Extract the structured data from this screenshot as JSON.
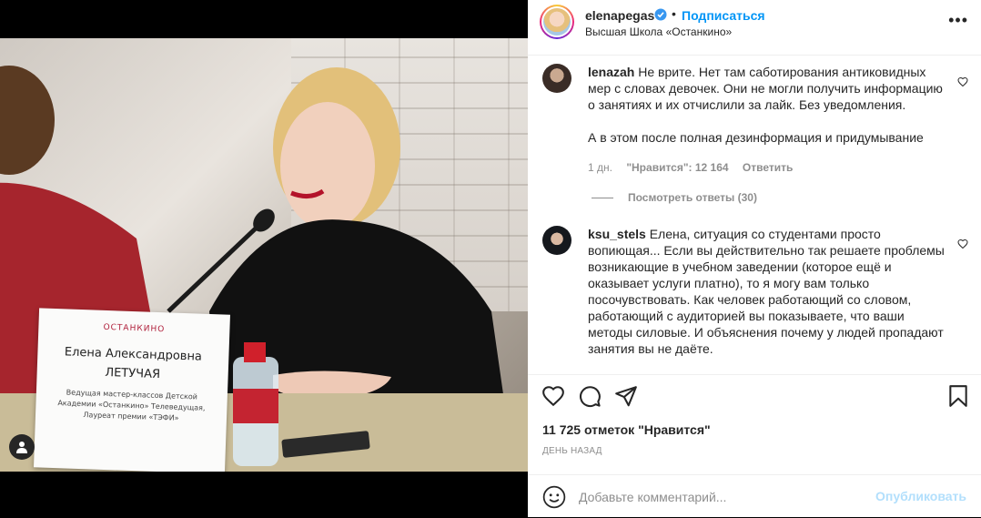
{
  "post": {
    "username": "elenapegas",
    "follow_label": "Подписаться",
    "separator": "•",
    "location": "Высшая Школа «Останкино»",
    "more_label": "•••"
  },
  "media": {
    "namecard": {
      "brand": "ОСТАНКИНО",
      "name": "Елена Александровна",
      "surname": "ЛЕТУЧАЯ",
      "description": "Ведущая мастер-классов Детской Академии «Останкино» Телеведущая, Лауреат премии «ТЭФИ»"
    }
  },
  "comments": [
    {
      "username": "lenazah",
      "text": "Не врите. Нет там саботирования антиковидных мер с словах девочек. Они не могли получить информацию о занятиях и их отчислили за лайк. Без уведомления.",
      "text2": "А в этом после полная дезинформация и придумывание",
      "time": "1 дн.",
      "likes": "\"Нравится\": 12 164",
      "reply_label": "Ответить",
      "view_replies": "Посмотреть ответы (30)"
    },
    {
      "username": "ksu_stels",
      "text": "Елена, ситуация со студентами просто вопиющая... Если вы действительно так решаете проблемы возникающие в учебном заведении (которое ещё и оказывает услуги платно), то я могу вам только посочувствовать. Как человек работающий со словом, работающий с аудиторией вы показываете, что ваши методы силовые. И объяснения почему у людей пропадают занятия вы не даёте."
    }
  ],
  "actions": {
    "likes_count": "11 725 отметок \"Нравится\"",
    "date": "ДЕНЬ НАЗАД"
  },
  "composer": {
    "placeholder": "Добавьте комментарий...",
    "post_label": "Опубликовать"
  },
  "colors": {
    "link_blue": "#0095f6",
    "post_disabled": "#b2dffc",
    "secondary_text": "#8e8e8e"
  }
}
